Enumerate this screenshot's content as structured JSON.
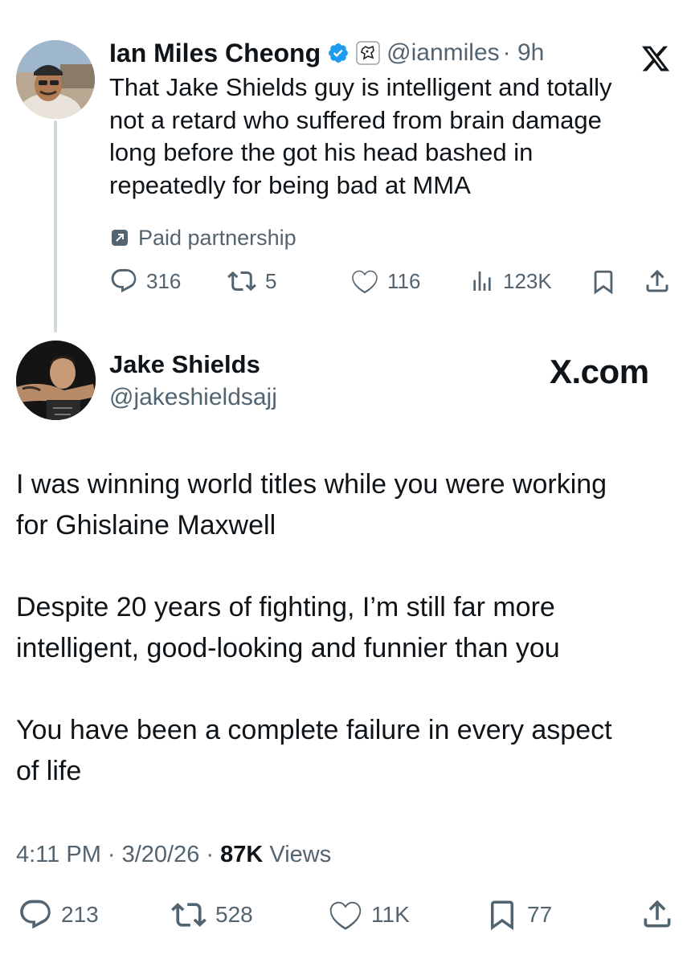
{
  "quoted_tweet": {
    "author_name": "Ian Miles Cheong",
    "handle": "@ianmiles",
    "time": "· 9h",
    "text_lines": [
      "That Jake Shields guy is intelligent and totally",
      "not a retard who suffered from brain damage",
      "long before the got his head bashed in",
      "repeatedly for being bad at MMA"
    ],
    "paid_label": "Paid partnership",
    "stats": {
      "replies": "316",
      "reposts": "5",
      "likes": "116",
      "views": "123K"
    },
    "icons": [
      "verified-badge-icon",
      "affiliate-badge-icon",
      "x-logo-icon",
      "paid-partnership-icon",
      "reply-icon",
      "repost-icon",
      "like-icon",
      "views-icon",
      "bookmark-icon",
      "share-icon"
    ]
  },
  "main_tweet": {
    "author_name": "Jake Shields",
    "handle": "@jakeshieldsajj",
    "brand": "X.com",
    "text_lines": [
      "I was winning world titles while you were working",
      "for Ghislaine Maxwell",
      "Despite 20 years of fighting, I’m still far more",
      "intelligent, good-looking and funnier than you",
      "You have been a complete failure in every aspect",
      "of life"
    ],
    "meta": {
      "time": "4:11 PM · 3/20/26 · ",
      "views_count": "87K",
      "views_label": " Views"
    },
    "stats": {
      "replies": "213",
      "reposts": "528",
      "likes": "11K",
      "bookmarks": "77"
    }
  },
  "colors": {
    "verified_blue": "#1d9bf0",
    "text": "#0f1419",
    "muted": "#536471",
    "thread_line": "#cfd9de"
  }
}
